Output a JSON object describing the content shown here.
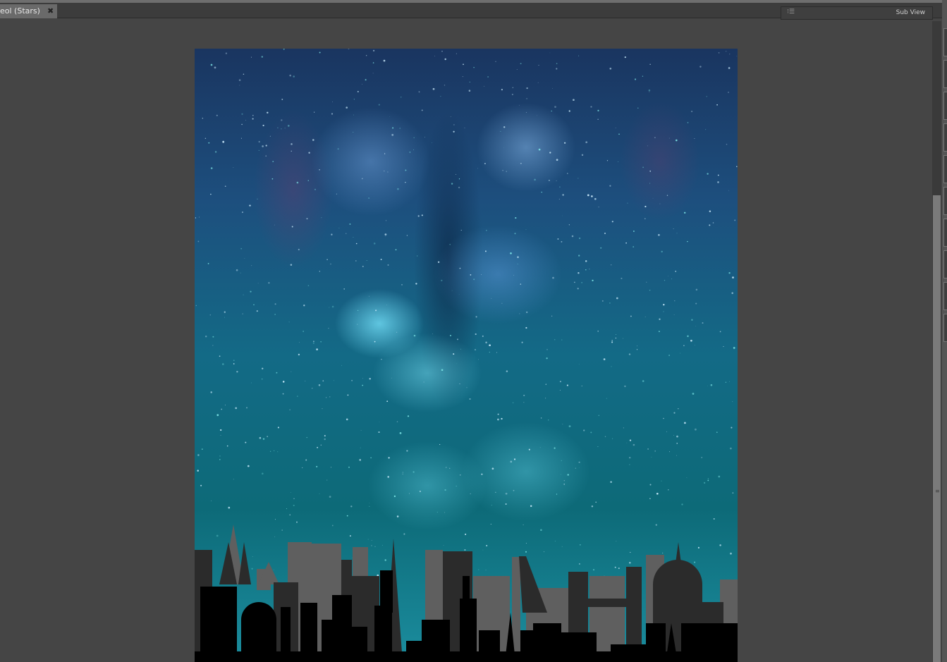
{
  "document_tab": {
    "title": "eol (Stars)",
    "close_icon": "close-icon"
  },
  "sub_view": {
    "title": "Sub View",
    "menu_icon": "panel-menu-icon"
  },
  "canvas": {
    "artwork": "Milky way night sky over city skyline"
  }
}
